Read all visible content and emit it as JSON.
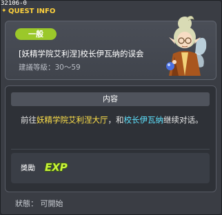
{
  "window": {
    "quest_id": "32106-0",
    "title": "QUEST INFO"
  },
  "quest": {
    "category": "一般",
    "name": "[妖精学院艾利涅]校长伊瓦纳的误会",
    "level": "建議等級：30～59"
  },
  "content": {
    "header": "内容",
    "desc_prefix": "前往",
    "desc_map": "妖精学院艾利涅大厅",
    "desc_mid": "，和",
    "desc_npc": "校长伊瓦纳",
    "desc_suffix": "继续对话。"
  },
  "reward": {
    "label": "獎勵",
    "exp_text": "EXP"
  },
  "status": {
    "text": "狀態： 可開始"
  },
  "colors": {
    "title": "#ffd23c",
    "badge": "#9bc82a",
    "map_highlight": "#ffe14a",
    "npc_highlight": "#5fe3ff"
  }
}
